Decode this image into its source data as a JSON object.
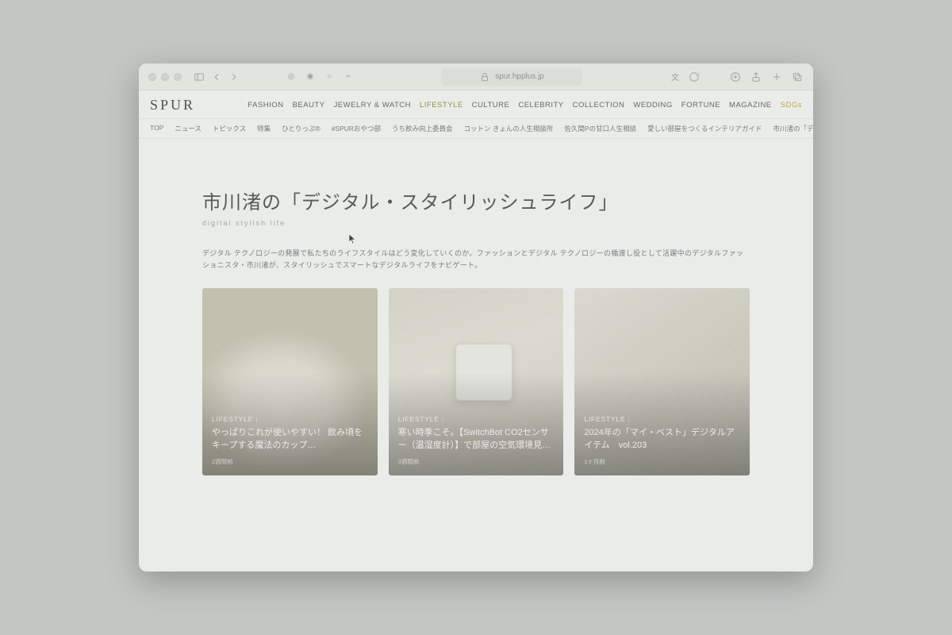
{
  "browser": {
    "url": "spur.hpplus.jp"
  },
  "site": {
    "logo": "SPUR",
    "main_nav": [
      "FASHION",
      "BEAUTY",
      "JEWELRY & WATCH",
      "LIFESTYLE",
      "CULTURE",
      "CELEBRITY",
      "COLLECTION",
      "WEDDING",
      "FORTUNE",
      "MAGAZINE",
      "SDGs"
    ],
    "main_nav_active": "LIFESTYLE",
    "sub_nav": [
      "TOP",
      "ニュース",
      "トピックス",
      "特集",
      "ひとりっぷ®",
      "#SPURおやつ部",
      "うち飲み向上委員会",
      "コットン きょんの人生相談所",
      "佐久間Pの甘口人生相談",
      "愛しい部屋をつくるインテリアガイド",
      "市川渚の「デジタル"
    ]
  },
  "page": {
    "title": "市川渚の「デジタル・スタイリッシュライフ」",
    "subtitle": "digital stylish life",
    "description": "デジタル テクノロジーの発展で私たちのライフスタイルはどう変化していくのか。ファッションとデジタル テクノロジーの橋渡し役として活躍中のデジタルファッショニスタ・市川渚が、スタイリッシュでスマートなデジタルライフをナビゲート。"
  },
  "cards": [
    {
      "category": "LIFESTYLE",
      "title": "やっぱりこれが使いやすい！ 飲み頃をキープする魔法のカップ…",
      "time": "2週間前"
    },
    {
      "category": "LIFESTYLE",
      "title": "寒い時季こそ。【SwitchBot CO2センサー（温湿度計）】で部屋の空気環境見…",
      "time": "3週間前"
    },
    {
      "category": "LIFESTYLE",
      "title": "2024年の「マイ・ベスト」デジタルアイテム　vol.203",
      "time": "1ヶ月前"
    }
  ]
}
